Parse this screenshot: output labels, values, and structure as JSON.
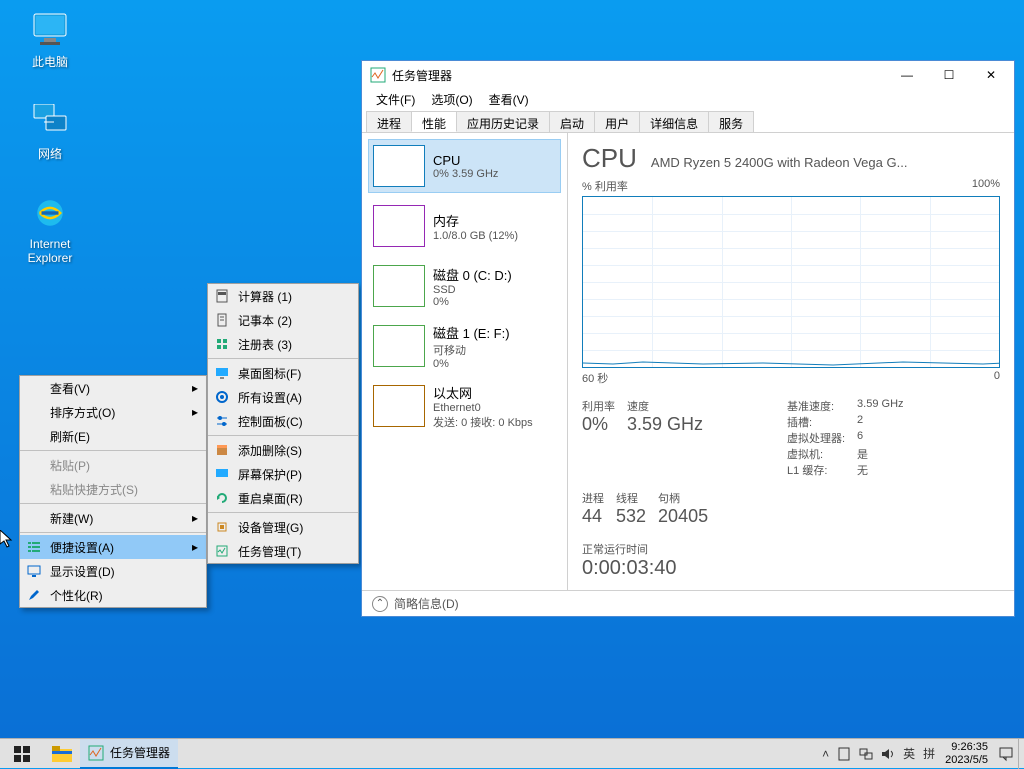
{
  "desktop": {
    "icons": [
      {
        "label": "此电脑"
      },
      {
        "label": "网络"
      },
      {
        "label": "Internet Explorer"
      }
    ]
  },
  "ctx1": {
    "view": "查看(V)",
    "sort": "排序方式(O)",
    "refresh": "刷新(E)",
    "paste": "粘贴(P)",
    "paste_shortcut": "粘贴快捷方式(S)",
    "new": "新建(W)",
    "quick_settings": "便捷设置(A)",
    "display": "显示设置(D)",
    "personalize": "个性化(R)"
  },
  "ctx2": {
    "calc": "计算器  (1)",
    "notepad": "记事本  (2)",
    "regedit": "注册表  (3)",
    "desk_icons": "桌面图标(F)",
    "all_settings": "所有设置(A)",
    "control_panel": "控制面板(C)",
    "add_remove": "添加删除(S)",
    "screen_protect": "屏幕保护(P)",
    "restart_desktop": "重启桌面(R)",
    "device_mgr": "设备管理(G)",
    "task_mgr": "任务管理(T)"
  },
  "tm": {
    "title": "任务管理器",
    "menu": {
      "file": "文件(F)",
      "options": "选项(O)",
      "view": "查看(V)"
    },
    "tabs": [
      "进程",
      "性能",
      "应用历史记录",
      "启动",
      "用户",
      "详细信息",
      "服务"
    ],
    "active_tab": 1,
    "sidebar": [
      {
        "name": "CPU",
        "stats": "0% 3.59 GHz",
        "type": "cpu"
      },
      {
        "name": "内存",
        "stats": "1.0/8.0 GB (12%)",
        "type": "mem"
      },
      {
        "name": "磁盘 0 (C: D:)",
        "stats_l1": "SSD",
        "stats_l2": "0%",
        "type": "disk"
      },
      {
        "name": "磁盘 1 (E: F:)",
        "stats_l1": "可移动",
        "stats_l2": "0%",
        "type": "disk"
      },
      {
        "name": "以太网",
        "stats_l1": "Ethernet0",
        "stats_l2": "发送: 0 接收: 0 Kbps",
        "type": "net"
      }
    ],
    "main": {
      "title": "CPU",
      "subtitle": "AMD Ryzen 5 2400G with Radeon Vega G...",
      "chart_label_left": "% 利用率",
      "chart_label_right": "100%",
      "axis_left": "60 秒",
      "axis_right": "0",
      "util_lbl": "利用率",
      "util_val": "0%",
      "speed_lbl": "速度",
      "speed_val": "3.59 GHz",
      "base_lbl": "基准速度:",
      "base_val": "3.59 GHz",
      "sockets_lbl": "插槽:",
      "sockets_val": "2",
      "vproc_lbl": "虚拟处理器:",
      "vproc_val": "6",
      "vmach_lbl": "虚拟机:",
      "vmach_val": "是",
      "l1_lbl": "L1 缓存:",
      "l1_val": "无",
      "proc_lbl": "进程",
      "proc_val": "44",
      "thread_lbl": "线程",
      "thread_val": "532",
      "handle_lbl": "句柄",
      "handle_val": "20405",
      "uptime_lbl": "正常运行时间",
      "uptime_val": "0:00:03:40"
    },
    "footer": "简略信息(D)"
  },
  "taskbar": {
    "app": "任务管理器",
    "ime1": "英",
    "ime2": "拼",
    "time": "9:26:35",
    "date": "2023/5/5"
  }
}
